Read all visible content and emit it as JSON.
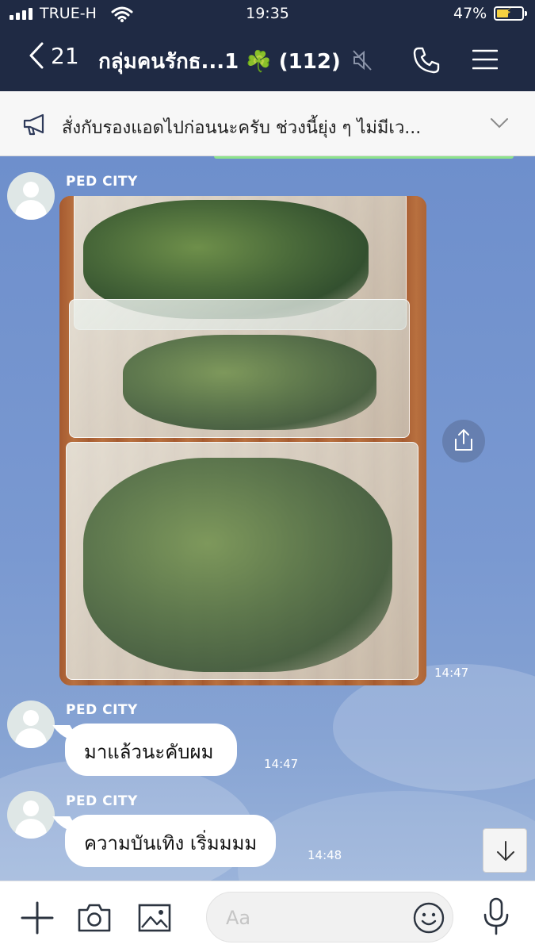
{
  "status_bar": {
    "carrier": "TRUE-H",
    "time": "19:35",
    "battery": "47%"
  },
  "header": {
    "back_count": "21",
    "title": "กลุ่มคนรักธ...1",
    "emoji": "☘️",
    "member_count": "(112)",
    "icons": [
      "chevron-left-icon",
      "muted-speaker-icon",
      "phone-icon",
      "menu-icon"
    ]
  },
  "announcement": {
    "icon": "megaphone-icon",
    "text": "สั่งกับรองแอดไปก่อนนะครับ ช่วงนี้ยุ่ง ๆ ไม่มีเว...",
    "chevron": "chevron-down-icon"
  },
  "messages": [
    {
      "sender": "PED CITY",
      "type": "image",
      "time": "14:47"
    },
    {
      "sender": "PED CITY",
      "type": "text",
      "text": "มาแล้วนะคับผม",
      "time": "14:47"
    },
    {
      "sender": "PED CITY",
      "type": "text",
      "text": "ความบันเทิง เริ่มมมม",
      "time": "14:48"
    }
  ],
  "input_bar": {
    "placeholder": "Aa",
    "icons": [
      "plus-icon",
      "camera-icon",
      "image-icon",
      "emoji-icon",
      "microphone-icon"
    ]
  },
  "colors": {
    "header_bg": "#1f2a44",
    "chat_bg": "#7a99d1",
    "bubble": "#ffffff",
    "accent_green": "#8ee38c"
  }
}
